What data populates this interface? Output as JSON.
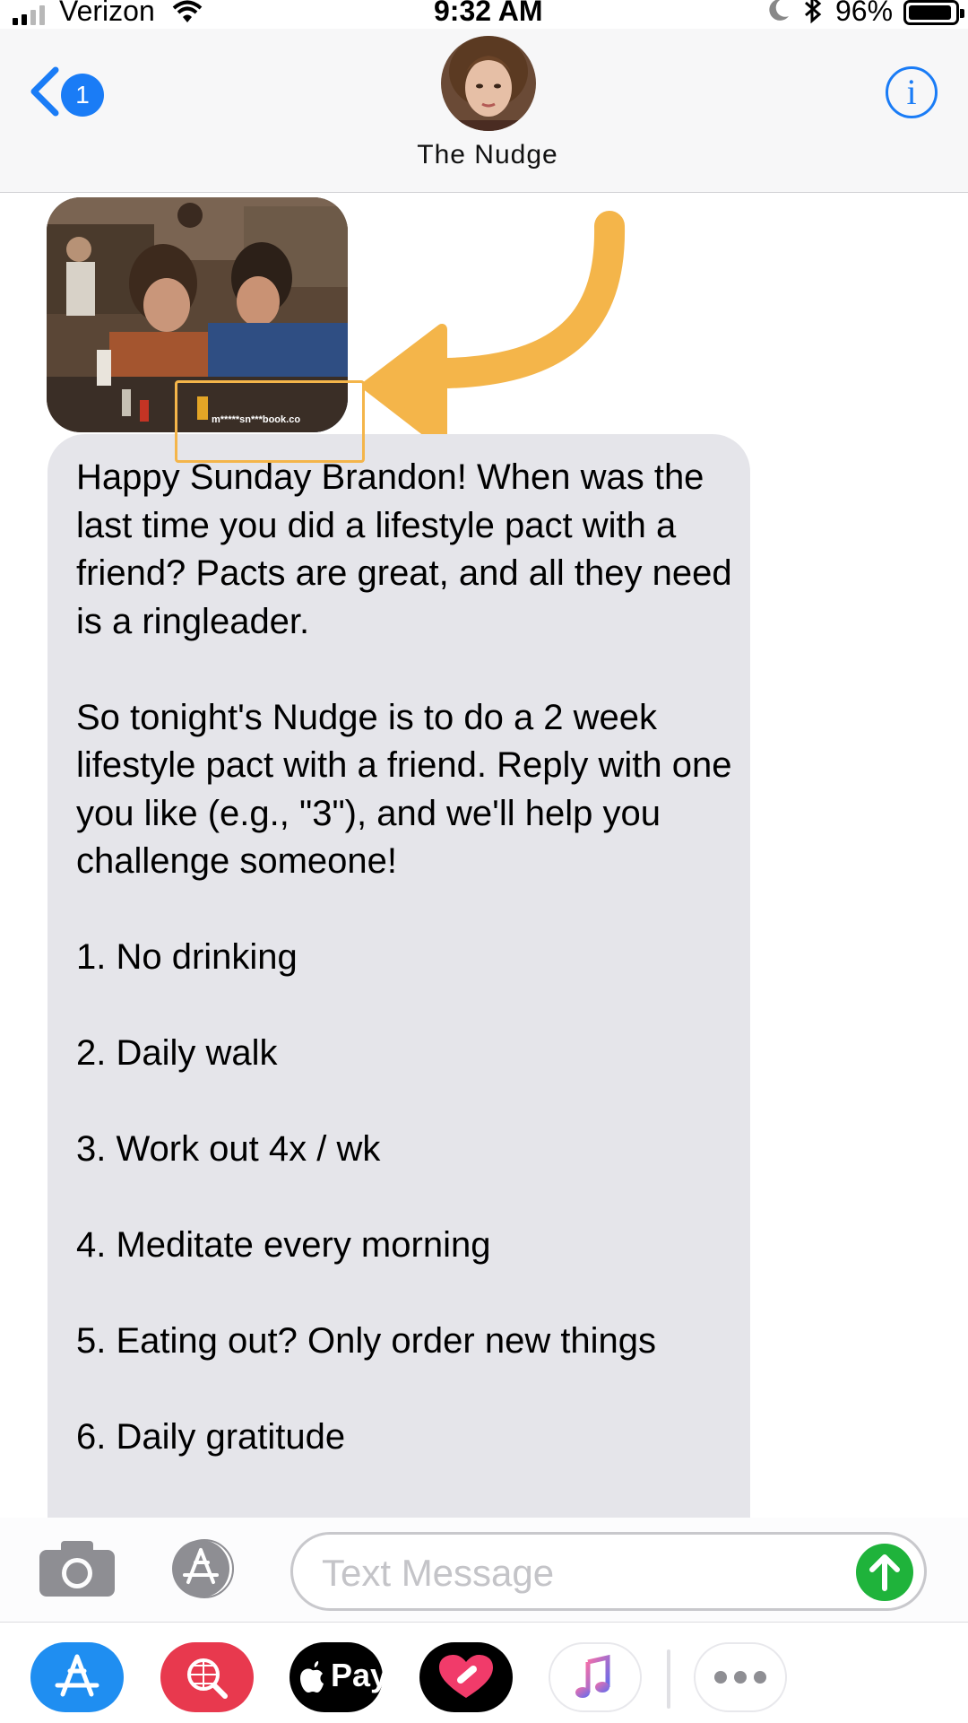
{
  "status_bar": {
    "carrier": "Verizon",
    "time": "9:32 AM",
    "battery_percent": "96%",
    "signal_bars": 2,
    "icons": [
      "signal-icon",
      "wifi-icon",
      "moon-icon",
      "bluetooth-icon",
      "battery-icon"
    ]
  },
  "header": {
    "back_badge": "1",
    "contact_name": "The Nudge",
    "info_label": "i",
    "icons": [
      "chevron-left-icon",
      "info-icon"
    ]
  },
  "conversation": {
    "image_watermark": "m*****sn***book.co",
    "message_text": "Happy Sunday Brandon! When was the last time you did a lifestyle pact with a friend? Pacts are great, and all they need is a ringleader.\n\nSo tonight's Nudge is to do a 2 week lifestyle pact with a friend. Reply with one you like (e.g., \"3\"), and we'll help you challenge someone!\n\n1. No drinking\n\n2. Daily walk\n\n3. Work out 4x / wk\n\n4. Meditate every morning\n\n5. Eating out? Only order new things\n\n6. Daily gratitude"
  },
  "input_bar": {
    "placeholder": "Text Message",
    "icons": [
      "camera-icon",
      "app-store-icon",
      "send-arrow-icon"
    ]
  },
  "app_drawer": {
    "apple_pay_label": "Pay",
    "apps": [
      "app-store-icon",
      "web-search-icon",
      "apple-pay-icon",
      "digital-touch-icon",
      "music-icon",
      "more-icon"
    ]
  },
  "colors": {
    "accent_blue": "#1a7cf6",
    "bubble_gray": "#e5e5ea",
    "send_green": "#1fb33b",
    "annotation_orange": "#f4b54a"
  }
}
